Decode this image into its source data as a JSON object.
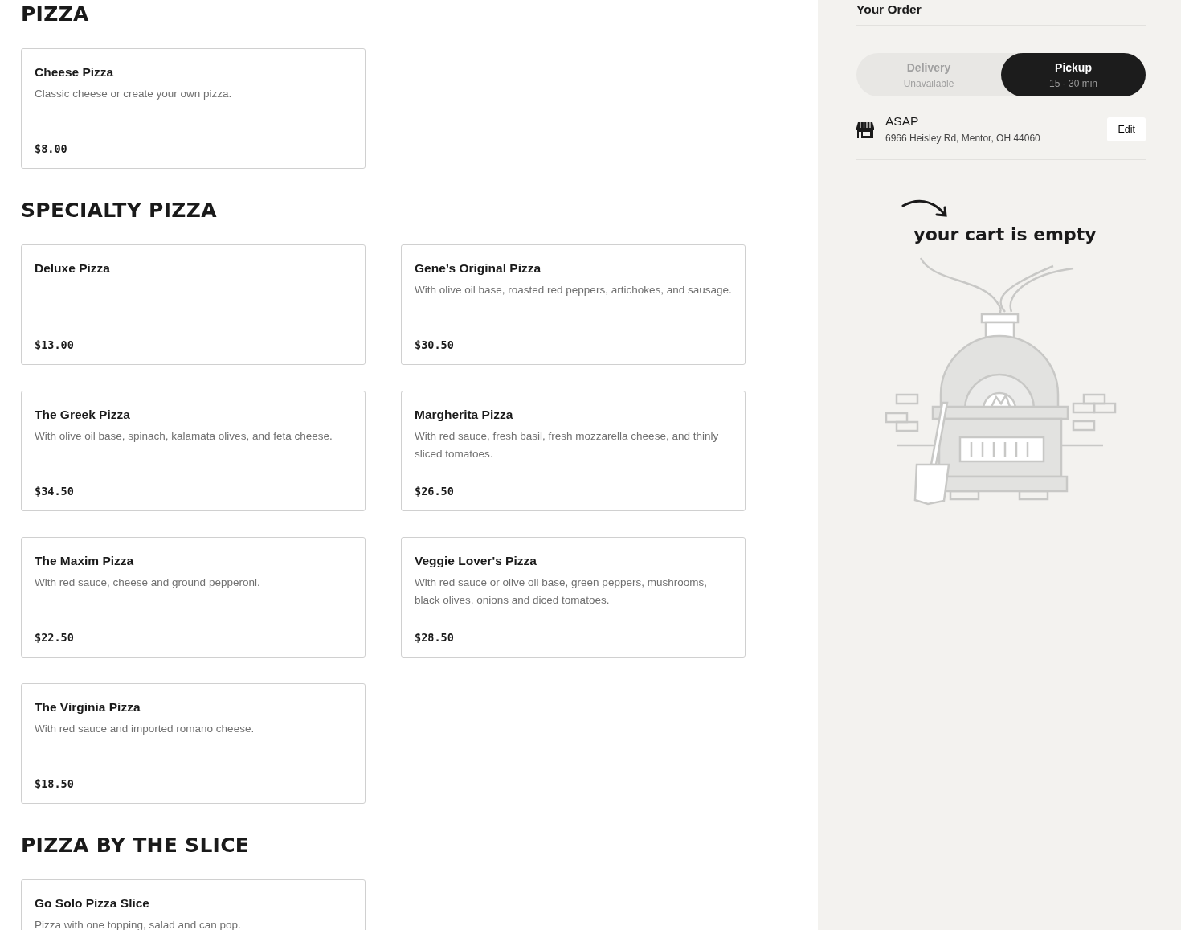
{
  "sections": [
    {
      "title": "PIZZA",
      "items": [
        {
          "name": "Cheese Pizza",
          "description": "Classic cheese or create your own pizza.",
          "price": "$8.00"
        }
      ]
    },
    {
      "title": "SPECIALTY PIZZA",
      "items": [
        {
          "name": "Deluxe Pizza",
          "price": "$13.00"
        },
        {
          "name": "Gene’s Original Pizza",
          "description": "With olive oil base, roasted red peppers, artichokes, and sausage.",
          "price": "$30.50"
        },
        {
          "name": "The Greek Pizza",
          "description": "With olive oil base, spinach, kalamata olives, and feta cheese.",
          "price": "$34.50"
        },
        {
          "name": "Margherita Pizza",
          "description": "With red sauce, fresh basil, fresh mozzarella cheese, and thinly sliced tomatoes.",
          "price": "$26.50"
        },
        {
          "name": "The Maxim Pizza",
          "description": "With red sauce, cheese and ground pepperoni.",
          "price": "$22.50"
        },
        {
          "name": "Veggie Lover's Pizza",
          "description": "With red sauce or olive oil base, green peppers, mushrooms, black olives, onions and diced tomatoes.",
          "price": "$28.50"
        },
        {
          "name": "The Virginia Pizza",
          "description": "With red sauce and imported romano cheese.",
          "price": "$18.50"
        }
      ]
    },
    {
      "title": "PIZZA BY THE SLICE",
      "items": [
        {
          "name": "Go Solo Pizza Slice",
          "description": "Pizza with one topping, salad and can pop."
        }
      ]
    }
  ],
  "order": {
    "title": "Your Order",
    "modes": [
      {
        "label": "Delivery",
        "sub": "Unavailable",
        "selected": false
      },
      {
        "label": "Pickup",
        "sub": "15 - 30 min",
        "selected": true
      }
    ],
    "time": "ASAP",
    "address": "6966 Heisley Rd, Mentor, OH 44060",
    "edit": "Edit",
    "empty_message": "your cart is empty"
  }
}
